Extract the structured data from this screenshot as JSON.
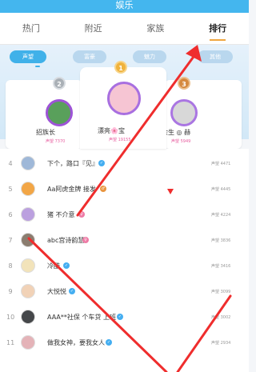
{
  "header": {
    "title": "娱乐"
  },
  "tabs": [
    {
      "label": "热门"
    },
    {
      "label": "附近"
    },
    {
      "label": "家族"
    },
    {
      "label": "排行"
    }
  ],
  "filters": [
    {
      "label": "声望"
    },
    {
      "label": "富豪"
    },
    {
      "label": "魅力"
    },
    {
      "label": "其他"
    }
  ],
  "podium": {
    "left": {
      "medal": "2",
      "name": "招族长",
      "score": "声望 7370"
    },
    "center": {
      "medal": "1",
      "name": "漂亮🌸宝",
      "score": "声望 19155"
    },
    "right": {
      "medal": "3",
      "name": "余生 ◎ 赫",
      "score": "声望 5949"
    }
  },
  "list": [
    {
      "rank": "4",
      "name": "下个，路口『见』",
      "score": "声望 4471"
    },
    {
      "rank": "5",
      "name": "Aa阿虎金牌 接发",
      "score": "声望 4445"
    },
    {
      "rank": "6",
      "name": "猪 不介意",
      "score": "声望 4224"
    },
    {
      "rank": "7",
      "name": "abc宫诗韵慧",
      "score": "声望 3836"
    },
    {
      "rank": "8",
      "name": "冷酷",
      "score": "声望 3416"
    },
    {
      "rank": "9",
      "name": "大悦悦",
      "score": "声望 3099"
    },
    {
      "rank": "10",
      "name": "AAA**社保 个车贷 上班",
      "score": "声望 3002"
    },
    {
      "rank": "11",
      "name": "做我女神，要我女人",
      "score": "声望 2934"
    }
  ],
  "colors": {
    "accent": "#44b6ee",
    "tab_underline": "#f0a640",
    "badge": "#44aef1",
    "arrow": "#ef2d2d",
    "score": "#e85ea0"
  }
}
